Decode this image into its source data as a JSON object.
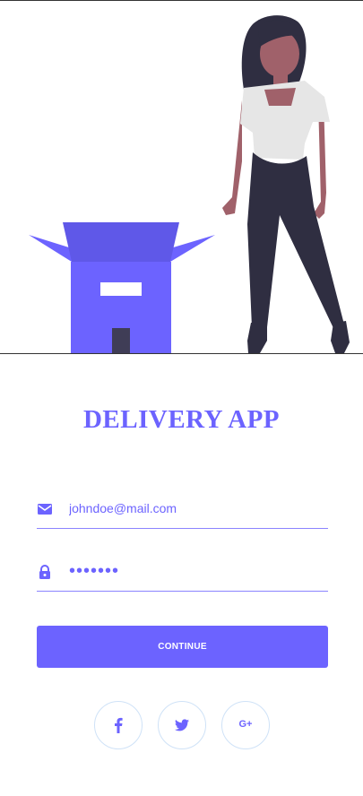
{
  "app": {
    "title": "DELIVERY APP"
  },
  "form": {
    "email": {
      "value": "johndoe@mail.com",
      "icon": "envelope-icon"
    },
    "password": {
      "value": "•••••••",
      "icon": "lock-icon"
    },
    "continue_label": "CONTINUE"
  },
  "social": {
    "facebook": {
      "icon": "facebook-icon"
    },
    "twitter": {
      "icon": "twitter-icon"
    },
    "google": {
      "icon": "google-plus-icon",
      "label": "G+"
    }
  },
  "colors": {
    "accent": "#6c63ff",
    "dark": "#2f2e41",
    "skin": "#a0616a",
    "shirt": "#e6e6e6"
  }
}
